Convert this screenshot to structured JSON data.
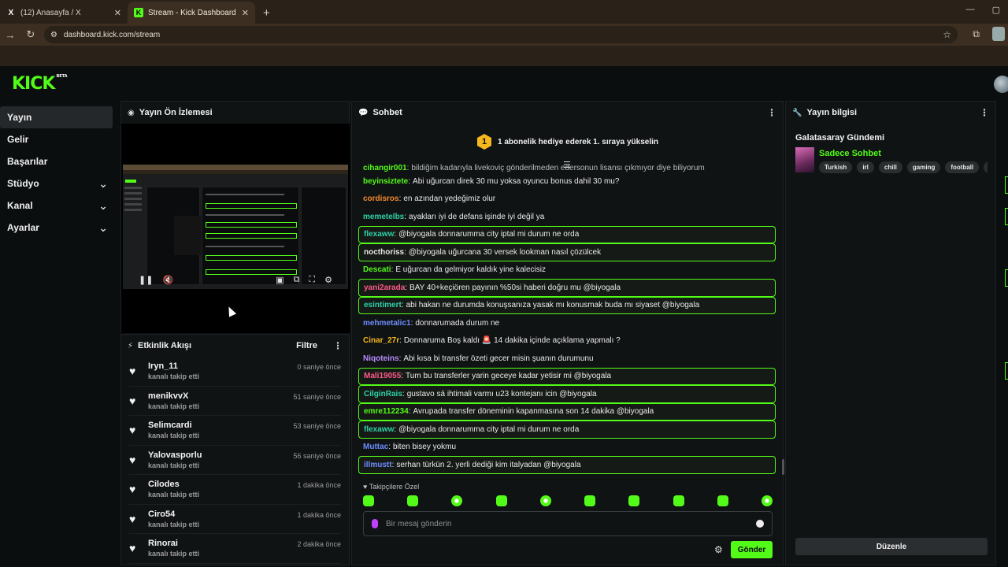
{
  "browser": {
    "tabs": [
      {
        "title": "(12) Anasayfa / X",
        "favicon": "x-icon",
        "active": false
      },
      {
        "title": "Stream - Kick Dashboard",
        "favicon": "kick-icon",
        "active": true
      }
    ],
    "url": "dashboard.kick.com/stream"
  },
  "brand": {
    "logo": "KICK",
    "beta": "BETA",
    "accent": "#53fc18"
  },
  "sidebar": {
    "items": [
      {
        "label": "Yayın",
        "active": true,
        "expandable": false
      },
      {
        "label": "Gelir",
        "active": false,
        "expandable": false
      },
      {
        "label": "Başarılar",
        "active": false,
        "expandable": false
      },
      {
        "label": "Stüdyo",
        "active": false,
        "expandable": true
      },
      {
        "label": "Kanal",
        "active": false,
        "expandable": true
      },
      {
        "label": "Ayarlar",
        "active": false,
        "expandable": true
      }
    ]
  },
  "preview": {
    "title": "Yayın Ön İzlemesi"
  },
  "activity": {
    "title": "Etkinlik Akışı",
    "filter_label": "Filtre",
    "items": [
      {
        "name": "Iryn_11",
        "action": "kanalı takip etti",
        "time": "0 saniye önce"
      },
      {
        "name": "menikvvX",
        "action": "kanalı takip etti",
        "time": "51 saniye önce"
      },
      {
        "name": "Selimcardi",
        "action": "kanalı takip etti",
        "time": "53 saniye önce"
      },
      {
        "name": "Yalovasporlu",
        "action": "kanalı takip etti",
        "time": "56 saniye önce"
      },
      {
        "name": "Cilodes",
        "action": "kanalı takip etti",
        "time": "1 dakika önce"
      },
      {
        "name": "Ciro54",
        "action": "kanalı takip etti",
        "time": "1 dakika önce"
      },
      {
        "name": "Rinorai",
        "action": "kanalı takip etti",
        "time": "2 dakika önce"
      }
    ]
  },
  "chat": {
    "title": "Sohbet",
    "pinned": {
      "badge": "1",
      "text": "1 abonelik hediye ederek 1. sıraya yükselin"
    },
    "messages": [
      {
        "user": "cihangir001",
        "text": "bildiğim kadarıyla livekoviç gönderilmeden edersonun lisansı çıkmıyor diye biliyorum",
        "color": "#53fc18",
        "highlight": false,
        "cut": true
      },
      {
        "user": "beyinsiztete",
        "text": "Abi uğurcan direk 30 mu yoksa oyuncu bonus dahil 30 mu?",
        "color": "#53fc18",
        "highlight": false
      },
      {
        "user": "cordisros",
        "text": "en azından yedeğimiz olur",
        "color": "#f58a2e",
        "highlight": false
      },
      {
        "user": "memetelbs",
        "text": "ayakları iyi de defans işinde iyi değil ya",
        "color": "#2ed1a8",
        "highlight": false
      },
      {
        "user": "flexaww",
        "text": "@biyogala donnarumma city iptal mi durum ne orda",
        "color": "#2ed1a8",
        "highlight": true
      },
      {
        "user": "nocthoriss",
        "text": "@biyogala uğurcana 30 versek lookman nasıl çözülcek",
        "color": "#e7e7e7",
        "highlight": true
      },
      {
        "user": "Descati",
        "text": "E uğurcan da gelmiyor kaldık yine kalecisiz",
        "color": "#53fc18",
        "highlight": false
      },
      {
        "user": "yani2arada",
        "text": "BAY 40+keçiören payının %50si haberi doğru mu @biyogala",
        "color": "#ff5a8a",
        "highlight": true
      },
      {
        "user": "esintimert",
        "text": "abi hakan ne durumda konuşsanıza yasak mı konusmak buda mı siyaset @biyogala",
        "color": "#2ed1a8",
        "highlight": true
      },
      {
        "user": "mehmetalic1",
        "text": "donnarumada durum ne",
        "color": "#6d8cff",
        "highlight": false
      },
      {
        "user": "Cinar_27r",
        "text": "Donnaruma Boş kaldı 🚨 14 dakika içinde açıklama yapmalı ?",
        "color": "#f5b81d",
        "highlight": false
      },
      {
        "user": "Niqoteins",
        "text": "Abi kısa bi transfer özeti gecer misin şuanın durumunu",
        "color": "#b98cff",
        "highlight": false
      },
      {
        "user": "Mali19055",
        "text": "Tum bu transferler yarin geceye kadar yetisir mi @biyogala",
        "color": "#ff5a8a",
        "highlight": true
      },
      {
        "user": "CilginRais",
        "text": "gustavo sá ihtimali varmı u23 kontejanı icin @biyogala",
        "color": "#2ed1a8",
        "highlight": true
      },
      {
        "user": "emre112234",
        "text": "Avrupada transfer döneminin kapanmasına son 14 dakika @biyogala",
        "color": "#53fc18",
        "highlight": true
      },
      {
        "user": "flexaww",
        "text": "@biyogala donnarumma city iptal mi durum ne orda",
        "color": "#2ed1a8",
        "highlight": true
      },
      {
        "user": "Muttac",
        "text": "biten bisey yokmu",
        "color": "#6d8cff",
        "highlight": false
      },
      {
        "user": "illmustt",
        "text": "serhan türkün 2. yerli dediği kim italyadan @biyogala",
        "color": "#6d8cff",
        "highlight": true
      }
    ],
    "followers_only": "Takipçilere Özel",
    "input_placeholder": "Bir mesaj gönderin",
    "send_label": "Gönder"
  },
  "info": {
    "title": "Yayın bilgisi",
    "stream_title": "Galatasaray Gündemi",
    "category": "Sadece Sohbet",
    "tags": [
      "Turkish",
      "irl",
      "chill",
      "gaming",
      "football",
      "Tur"
    ],
    "edit_label": "Düzenle"
  }
}
